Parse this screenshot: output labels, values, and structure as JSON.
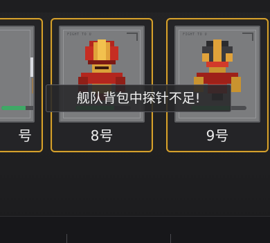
{
  "cards": [
    {
      "name": "号",
      "hp": 0.7,
      "accent": "#d6a12d",
      "portrait_tag": ""
    },
    {
      "name": "8号",
      "hp": 0.7,
      "accent": "#d6a12d",
      "portrait_tag": "FIGHT TO U"
    },
    {
      "name": "9号",
      "hp": 0.7,
      "accent": "#d6a12d",
      "portrait_tag": "FIGHT TO U"
    }
  ],
  "toast": {
    "message": "舰队背包中探针不足!"
  },
  "bottom_bar": {
    "items": [
      "",
      "",
      ""
    ]
  },
  "colors": {
    "card_border": "#d6a12d",
    "hp_bar": "#3fa866",
    "portrait_bg": "#7b7c7e"
  }
}
